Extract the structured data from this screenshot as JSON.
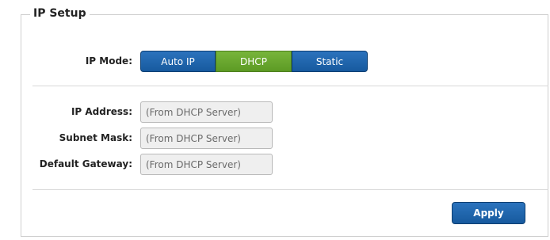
{
  "section": {
    "title": "IP Setup"
  },
  "ip_mode": {
    "label": "IP Mode:",
    "options": [
      "Auto IP",
      "DHCP",
      "Static"
    ],
    "selected": "DHCP"
  },
  "fields": {
    "ip_address": {
      "label": "IP Address:",
      "placeholder": "(From DHCP Server)"
    },
    "subnet_mask": {
      "label": "Subnet Mask:",
      "placeholder": "(From DHCP Server)"
    },
    "default_gateway": {
      "label": "Default Gateway:",
      "placeholder": "(From DHCP Server)"
    }
  },
  "actions": {
    "apply_label": "Apply"
  },
  "colors": {
    "button_blue": "#1f66ad",
    "selected_green": "#6aa82f"
  }
}
